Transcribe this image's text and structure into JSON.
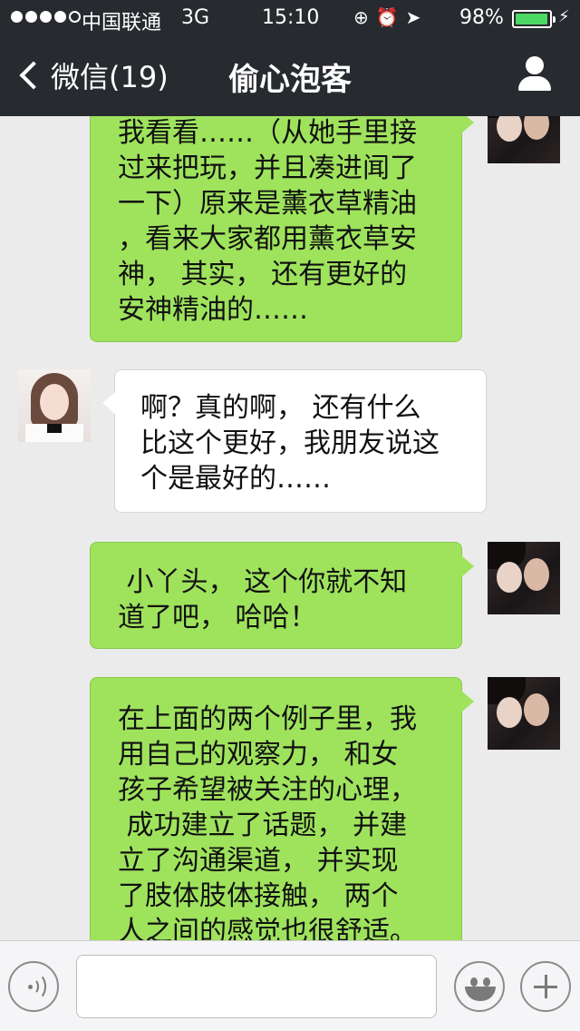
{
  "status_bar": {
    "carrier": "中国联通",
    "network": "3G",
    "time": "15:10",
    "battery_percent": "98%",
    "battery_level": 0.98,
    "icons": [
      "signal-dots",
      "rotation-lock-icon",
      "alarm-icon",
      "location-icon",
      "battery-icon",
      "charging-icon"
    ]
  },
  "nav": {
    "back_label": "微信(19)",
    "title": "偷心泡客"
  },
  "messages": [
    {
      "sender": "me",
      "lines": [
        "我看看……（从她手里接",
        "过来把玩，并且凑进闻了",
        "一下）原来是薰衣草精油",
        "，看来大家都用薰衣草安",
        "神， 其实， 还有更好的",
        "安神精油的……"
      ]
    },
    {
      "sender": "her",
      "lines": [
        "啊？真的啊， 还有什么",
        "比这个更好，我朋友说这",
        "个是最好的……"
      ]
    },
    {
      "sender": "me",
      "lines": [
        " 小丫头， 这个你就不知",
        "道了吧， 哈哈！"
      ]
    },
    {
      "sender": "me",
      "lines": [
        "在上面的两个例子里，我",
        "用自己的观察力， 和女",
        "孩子希望被关注的心理，",
        " 成功建立了话题， 并建",
        "立了沟通渠道， 并实现",
        "了肢体肢体接触， 两个",
        "人之间的感觉也很舒适。"
      ]
    }
  ],
  "input_bar": {
    "text_value": "",
    "icons": [
      "voice-icon",
      "emoji-icon",
      "plus-icon"
    ]
  },
  "colors": {
    "nav_background": "#272a2f",
    "outgoing_bubble": "#9fe35d",
    "incoming_bubble": "#ffffff",
    "chat_background": "#ebebeb",
    "battery_fill": "#4cd964"
  }
}
